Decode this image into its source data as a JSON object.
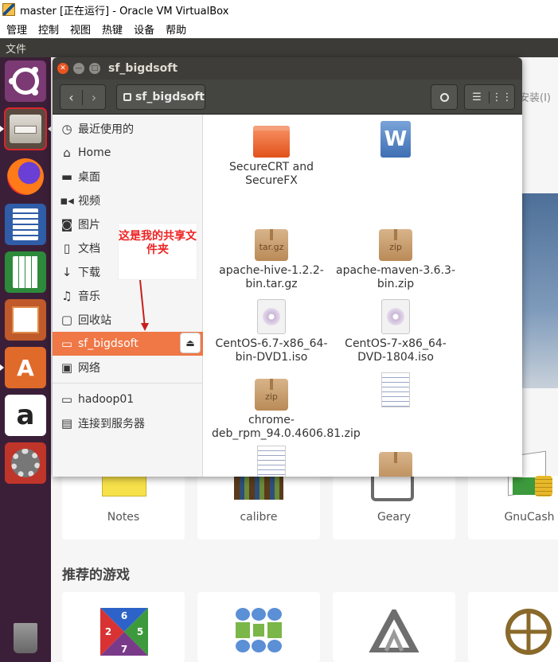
{
  "window": {
    "title": "master [正在运行] - Oracle VM VirtualBox"
  },
  "vm_menu": [
    "管理",
    "控制",
    "视图",
    "热键",
    "设备",
    "帮助"
  ],
  "ubuntu_menu": {
    "file": "文件"
  },
  "launcher": [
    "ubuntu-dash-icon",
    "files-icon",
    "firefox-icon",
    "writer-icon",
    "calc-icon",
    "impress-icon",
    "software-center-icon",
    "amazon-icon",
    "settings-icon",
    "trash-icon"
  ],
  "file_manager": {
    "title": "sf_bigdsoft",
    "path": "sf_bigdsoft",
    "sidebar": [
      {
        "icon": "clock-icon",
        "label": "最近使用的"
      },
      {
        "icon": "home-icon",
        "label": "Home"
      },
      {
        "icon": "folder-icon",
        "label": "桌面"
      },
      {
        "icon": "video-icon",
        "label": "视频"
      },
      {
        "icon": "camera-icon",
        "label": "图片"
      },
      {
        "icon": "document-icon",
        "label": "文档"
      },
      {
        "icon": "download-icon",
        "label": "下载"
      },
      {
        "icon": "music-icon",
        "label": "音乐"
      },
      {
        "icon": "trash-icon",
        "label": "回收站"
      },
      {
        "icon": "drive-icon",
        "label": "sf_bigdsoft"
      },
      {
        "icon": "network-icon",
        "label": "网络"
      },
      {
        "icon": "drive-icon",
        "label": "hadoop01"
      },
      {
        "icon": "server-icon",
        "label": "连接到服务器"
      }
    ],
    "files": [
      {
        "name": "SecureCRT and SecureFX",
        "type": "folder"
      },
      {
        "name": "",
        "type": "word"
      },
      {
        "name": "apache-hive-1.2.2-bin.tar.gz",
        "type": "archive",
        "badge": "tar.gz"
      },
      {
        "name": "apache-maven-3.6.3-bin.zip",
        "type": "archive",
        "badge": "zip"
      },
      {
        "name": "CentOS-6.7-x86_64-bin-DVD1.iso",
        "type": "disc"
      },
      {
        "name": "CentOS-7-x86_64-DVD-1804.iso",
        "type": "disc"
      },
      {
        "name": "chrome-deb_rpm_94.0.4606.81.zip",
        "type": "archive",
        "badge": "zip"
      },
      {
        "name": "",
        "type": "text"
      }
    ]
  },
  "annotation": "这是我的共享文件夹",
  "software_center": {
    "install": "安装(I)",
    "apps": [
      "Notes",
      "calibre",
      "Geary",
      "GnuCash"
    ],
    "games_heading": "推荐的游戏",
    "game_badge": [
      "6",
      "2",
      "5",
      "7"
    ]
  },
  "colors": {
    "accent": "#f07746",
    "launcher": "#3b1f38",
    "annotation": "#e22222"
  }
}
